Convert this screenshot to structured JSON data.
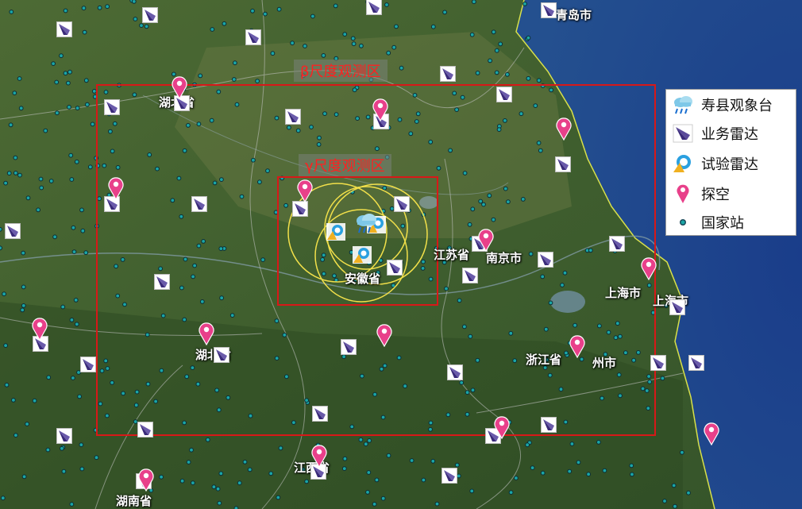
{
  "regions": {
    "beta_label": "β尺度观测区",
    "gamma_label": "γ尺度观测区"
  },
  "cities": {
    "qingdao": "青岛市",
    "jiangsu": "江苏省",
    "nanjing": "南京市",
    "anhui": "安徽省",
    "shanghai_a": "上海市",
    "shanghai_b": "上海市",
    "zhejiang": "浙江省",
    "hangzhou": "州市",
    "hubei": "湖北省",
    "hunan_mid": "湖北省",
    "jiangxi": "江西省",
    "hunan": "湖南省"
  },
  "legend": {
    "items": [
      {
        "label": "寿县观象台",
        "icon": "cloud-rain-icon"
      },
      {
        "label": "业务雷达",
        "icon": "radar-dish-icon"
      },
      {
        "label": "试验雷达",
        "icon": "test-radar-icon"
      },
      {
        "label": "探空",
        "icon": "map-pin-icon"
      },
      {
        "label": "国家站",
        "icon": "station-dot-icon"
      }
    ]
  },
  "colors": {
    "region_border": "#d81818",
    "region_label": "#ff2020",
    "pin": "#e8408a",
    "station": "#1aa6a6",
    "radar": "#5a4a9a",
    "range_circle": "#f2e04a"
  }
}
